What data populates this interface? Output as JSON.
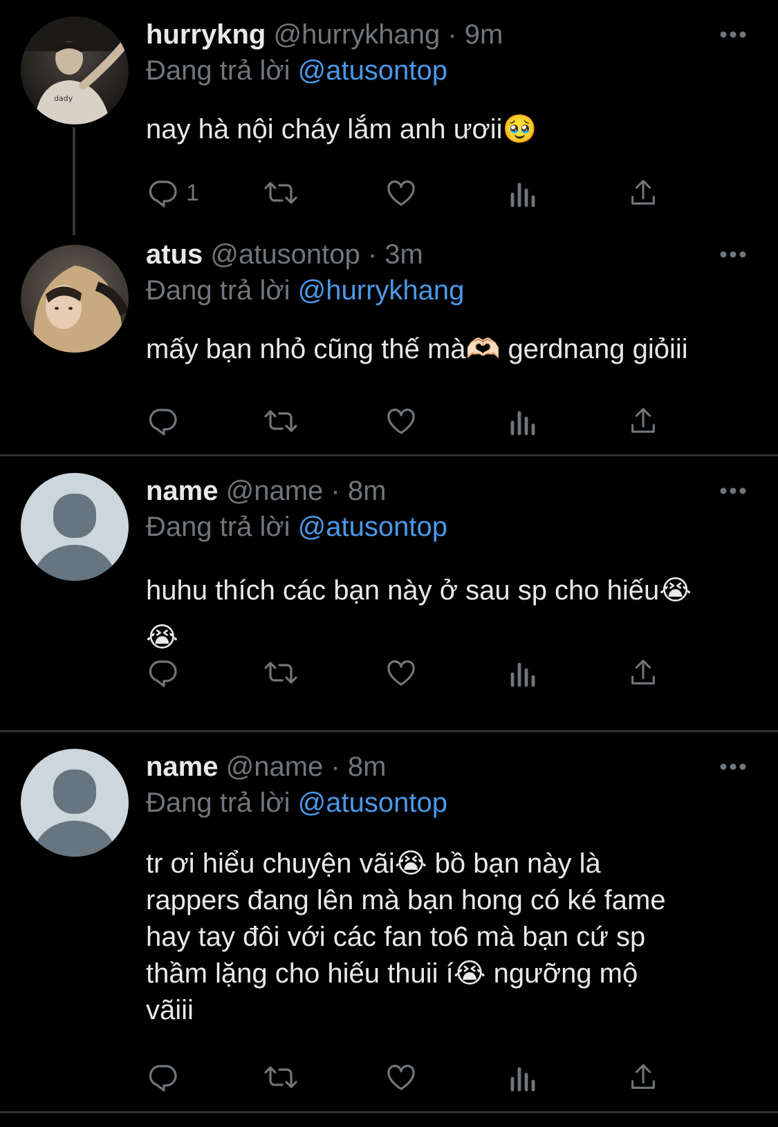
{
  "tweets": [
    {
      "display_name": "hurrykng",
      "handle": "@hurrykhang",
      "separator": "·",
      "time": "9m",
      "replying_prefix": "Đang trả lời",
      "replying_to": "@atusontop",
      "text": "nay hà nội cháy lắm anh ươii🥹",
      "reply_count": "1"
    },
    {
      "display_name": "atus",
      "handle": "@atusontop",
      "separator": "·",
      "time": "3m",
      "replying_prefix": "Đang trả lời",
      "replying_to": "@hurrykhang",
      "text": "mấy bạn nhỏ cũng thế mà🫶🏻  gerdnang giỏiii",
      "reply_count": ""
    },
    {
      "display_name": "name",
      "handle": "@name",
      "separator": "·",
      "time": "8m",
      "replying_prefix": "Đang trả lời",
      "replying_to": "@atusontop",
      "text": "huhu thích các bạn này ở sau sp cho hiếu😭\n😭",
      "reply_count": ""
    },
    {
      "display_name": "name",
      "handle": "@name",
      "separator": "·",
      "time": "8m",
      "replying_prefix": "Đang trả lời",
      "replying_to": "@atusontop",
      "text": "tr ơi hiểu chuyện vãi😭  bồ bạn này là\nrappers đang lên mà bạn hong có ké fame\nhay tay đôi với các fan to6 mà bạn cứ sp\nthầm lặng cho hiếu thuii í😭  ngưỡng mộ\nvãiii",
      "reply_count": ""
    }
  ],
  "icons": {
    "reply": "reply-icon",
    "retweet": "retweet-icon",
    "like": "heart-icon",
    "views": "views-icon",
    "share": "share-icon",
    "more": "more-icon"
  },
  "colors": {
    "background": "#000000",
    "text": "#e7e9ea",
    "secondary": "#71767b",
    "mention": "#4a99e9",
    "divider": "#2f3336",
    "default_avatar_bg": "#ccd6dd",
    "default_avatar_fg": "#66757f"
  }
}
